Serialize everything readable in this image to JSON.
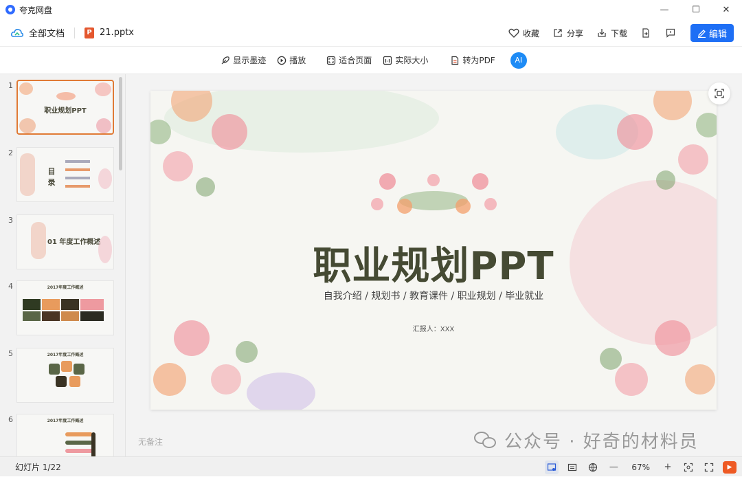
{
  "app": {
    "title": "夸克网盘"
  },
  "window": {
    "minimize": "—",
    "maximize": "☐",
    "close": "✕"
  },
  "toolbar": {
    "all_docs": "全部文档",
    "file_name": "21.pptx",
    "ppt_badge": "P",
    "favorite": "收藏",
    "share": "分享",
    "download": "下载",
    "edit": "编辑"
  },
  "viewbar": {
    "ink": "显示墨迹",
    "play": "播放",
    "fit": "适合页面",
    "actual": "实际大小",
    "pdf": "转为PDF",
    "ai": "AI"
  },
  "thumbnails": [
    {
      "num": "1",
      "title": "职业规划PPT"
    },
    {
      "num": "2",
      "title": "目录"
    },
    {
      "num": "3",
      "title": "01  年度工作概述"
    },
    {
      "num": "4",
      "title": "2017年度工作概述"
    },
    {
      "num": "5",
      "title": "2017年度工作概述"
    },
    {
      "num": "6",
      "title": "2017年度工作概述"
    }
  ],
  "slide": {
    "title": "职业规划PPT",
    "subtitle": "自我介绍 / 规划书 / 教育课件 / 职业规划 / 毕业就业",
    "reporter": "汇报人：XXX"
  },
  "notes_placeholder": "无备注",
  "watermark": "公众号 · 好奇的材料员",
  "status": {
    "slide_count": "幻灯片 1/22",
    "zoom": "67%"
  }
}
